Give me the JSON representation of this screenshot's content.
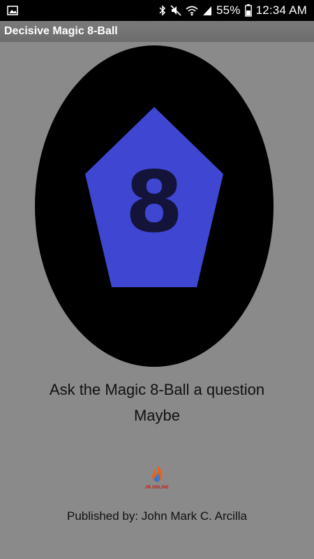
{
  "status_bar": {
    "battery": "55%",
    "time": "12:34 AM",
    "icons": [
      "image-icon",
      "bluetooth-icon",
      "mute-icon",
      "wifi-icon",
      "signal-icon",
      "battery-icon"
    ]
  },
  "app_bar": {
    "title": "Decisive Magic 8-Ball"
  },
  "ball": {
    "number": "8",
    "colors": {
      "ball": "#000000",
      "pentagon": "#3f46d2",
      "number": "#14143a"
    }
  },
  "main": {
    "prompt": "Ask the Magic 8-Ball a question",
    "answer": "Maybe"
  },
  "logo": {
    "text": "JR.ONLINE"
  },
  "footer": {
    "publisher": "Published by: John Mark C. Arcilla"
  },
  "colors": {
    "background": "#8a8a8a",
    "status_bar": "#000000",
    "app_bar": "#737373"
  }
}
